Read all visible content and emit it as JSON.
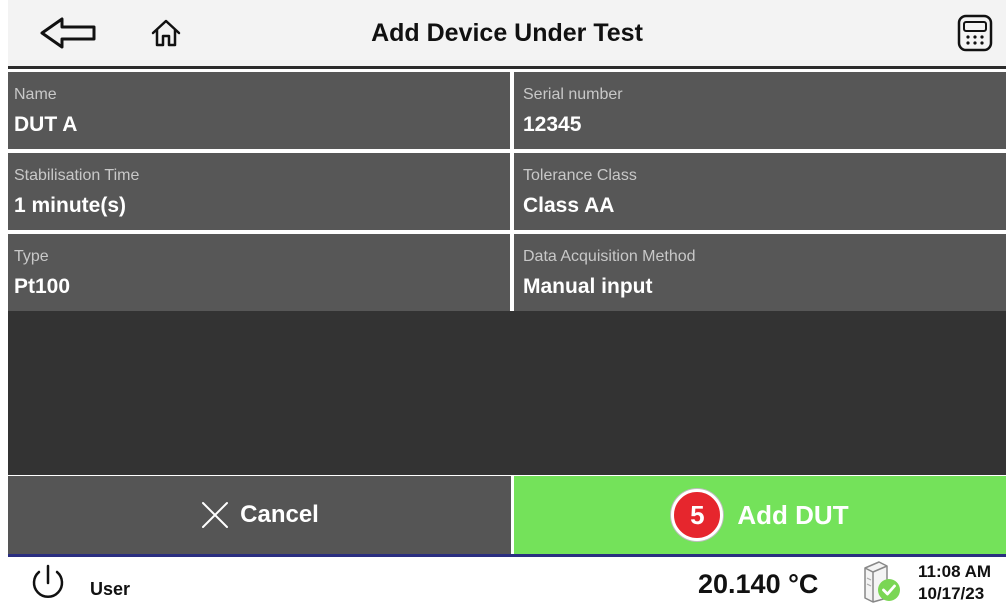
{
  "header": {
    "title": "Add Device Under Test"
  },
  "fields": [
    {
      "label": "Name",
      "value": "DUT A"
    },
    {
      "label": "Serial number",
      "value": "12345"
    },
    {
      "label": "Stabilisation Time",
      "value": "1 minute(s)"
    },
    {
      "label": "Tolerance Class",
      "value": "Class AA"
    },
    {
      "label": "Type",
      "value": "Pt100"
    },
    {
      "label": "Data Acquisition Method",
      "value": "Manual input"
    }
  ],
  "actions": {
    "cancel_label": "Cancel",
    "add_label": "Add DUT",
    "step_badge": "5"
  },
  "status": {
    "user": "User",
    "temperature": "20.140 °C",
    "time": "11:08 AM",
    "date": "10/17/23"
  },
  "icons": [
    "back-arrow-icon",
    "home-icon",
    "calculator-icon",
    "close-icon",
    "power-icon",
    "printer-icon",
    "check-icon"
  ],
  "colors": {
    "accent_green": "#74e25a",
    "badge_red": "#e6262d",
    "field_bg": "#575757",
    "divider_blue": "#2a2e80"
  }
}
